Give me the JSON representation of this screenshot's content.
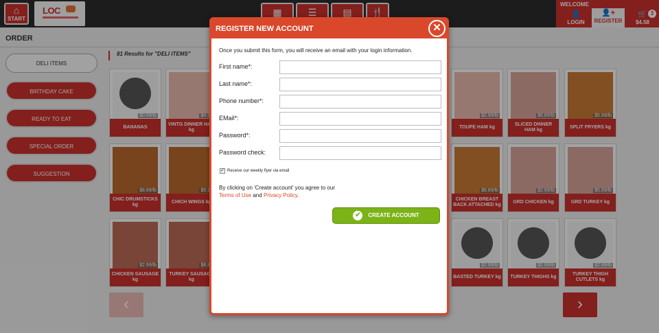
{
  "topbar": {
    "start_label": "START",
    "logo_text": "LOC",
    "view_tabs": [
      "grid-view-icon",
      "list-view-icon",
      "flyer-icon",
      "menu-icon"
    ],
    "welcome": "WELCOME",
    "login_label": "LOGIN",
    "register_label": "REGISTER",
    "cart_total": "$4.58",
    "cart_count": "3"
  },
  "page": {
    "title": "ORDER",
    "results_text": "81 Results for \"DELI ITEMS\""
  },
  "sidebar": {
    "items": [
      {
        "label": "DELI ITEMS",
        "active": true
      },
      {
        "label": "BIRTHDAY CAKE"
      },
      {
        "label": "READY TO EAT"
      },
      {
        "label": "SPECIAL ORDER"
      },
      {
        "label": "SUGGESTION"
      }
    ]
  },
  "products": [
    {
      "label": "BANANAS",
      "price": "$0.69/lb"
    },
    {
      "label": "VINTG DINNER HAM kg",
      "price": "$4.99"
    },
    {
      "label": "TOUPE HAM kg",
      "price": "$2.99/lb"
    },
    {
      "label": "SLICED DINNER HAM kg",
      "price": "$8.89/lb"
    },
    {
      "label": "SPLIT FRYERS kg",
      "price": "$5.99/lb"
    },
    {
      "label": "CHIC DRUMSTICKS kg",
      "price": "$8.89/lb"
    },
    {
      "label": "CHICH WINGS kg",
      "price": "$5.99"
    },
    {
      "label": "CHICKEN BREAST BACK ATTACHED kg",
      "price": "$8.89/lb"
    },
    {
      "label": "GRD CHICKEN kg",
      "price": "$2.99/lb"
    },
    {
      "label": "GRD TURKEY kg",
      "price": "$5.99/lb"
    },
    {
      "label": "CHICKEN SAUSAGE kg",
      "price": "$2.99/lb"
    },
    {
      "label": "TURKEY SAUSAGE kg",
      "price": "$8.89"
    },
    {
      "label": "BASTED TURKEY kg",
      "price": "$2.99/lb"
    },
    {
      "label": "TURKEY THIGHS kg",
      "price": "$2.99/lb"
    },
    {
      "label": "TURKEY THIGH CUTLETS kg",
      "price": "$2.99/lb"
    }
  ],
  "modal": {
    "title": "REGISTER NEW ACCOUNT",
    "intro": "Once you submit this form, you will receive an email with your login information.",
    "fields": [
      {
        "label": "First name*:",
        "value": ""
      },
      {
        "label": "Last name*:",
        "value": ""
      },
      {
        "label": "Phone number*:",
        "value": ""
      },
      {
        "label": "EMail*:",
        "value": ""
      },
      {
        "label": "Password*:",
        "value": ""
      },
      {
        "label": "Password check:",
        "value": ""
      }
    ],
    "checkbox_label": "Receive our weekly flyer via email",
    "checkbox_checked": true,
    "agree_text": "By clicking on 'Create account' you agree to our",
    "terms_link": "Terms of Use",
    "and_text": "and",
    "privacy_link": "Privacy Policy",
    "button_label": "CREATE ACCOUNT"
  }
}
